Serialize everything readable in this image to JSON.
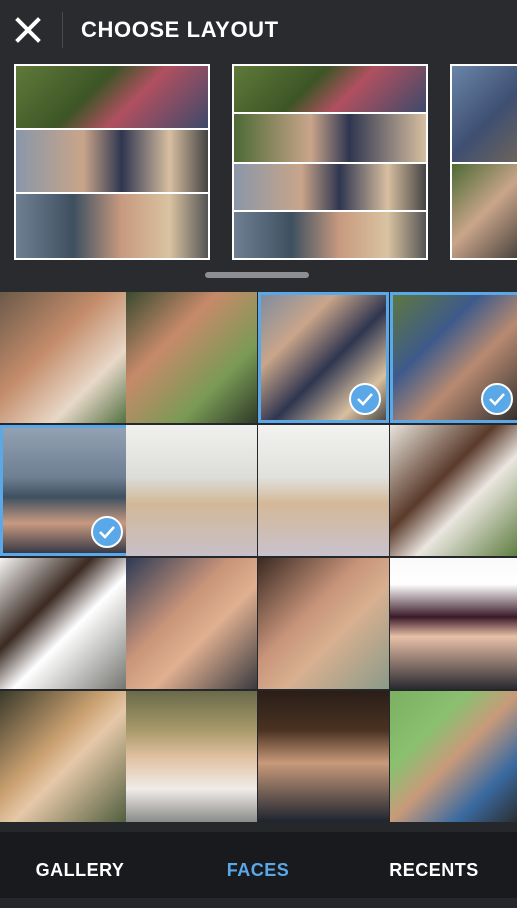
{
  "header": {
    "title": "CHOOSE LAYOUT",
    "close_icon": "close-icon"
  },
  "layouts": [
    {
      "name": "layout-three-rows"
    },
    {
      "name": "layout-four-rows"
    },
    {
      "name": "layout-partial"
    }
  ],
  "photos_selected": [
    false,
    false,
    true,
    true,
    true,
    false,
    false,
    false,
    false,
    false,
    false,
    false,
    false,
    false,
    false,
    false
  ],
  "tabs": {
    "gallery": "GALLERY",
    "faces": "FACES",
    "recents": "RECENTS",
    "active": "faces"
  },
  "colors": {
    "accent": "#5aa8e8",
    "background": "#26272b",
    "text": "#ffffff"
  }
}
